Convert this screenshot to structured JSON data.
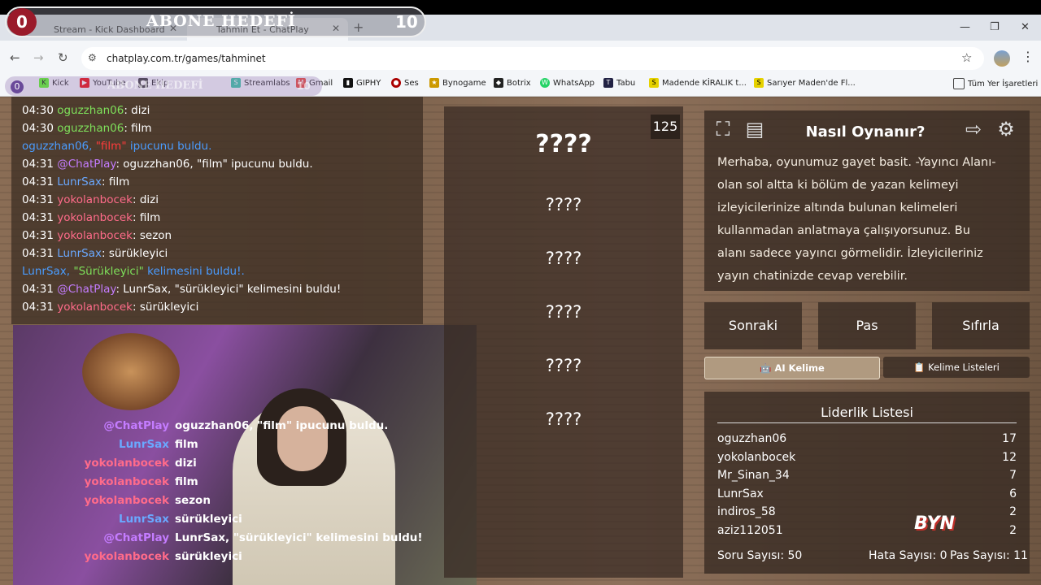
{
  "browser": {
    "tabs": [
      {
        "label": "Stream - Kick Dashboard"
      },
      {
        "label": "Tahmin Et - ChatPlay"
      }
    ],
    "url": "chatplay.com.tr/games/tahminet",
    "bookmarks": [
      {
        "label": "Kick"
      },
      {
        "label": "YouTube"
      },
      {
        "label": "Ekip"
      },
      {
        "label": "Streamlabs"
      },
      {
        "label": "Gmail"
      },
      {
        "label": "GIPHY"
      },
      {
        "label": "Ses"
      },
      {
        "label": "Bynogame"
      },
      {
        "label": "Botrix"
      },
      {
        "label": "WhatsApp"
      },
      {
        "label": "Tabu"
      },
      {
        "label": "Madende KİRALIK t..."
      },
      {
        "label": "Sarıyer Maden'de Fl..."
      }
    ],
    "all_bookmarks": "Tüm Yer İşaretleri"
  },
  "goal": {
    "current": "0",
    "title": "ABONE HEDEFİ",
    "target": "10"
  },
  "chat": [
    {
      "time": "04:30",
      "user": "oguzzhan06",
      "msg": ": dizi",
      "color": "#7ee05a"
    },
    {
      "time": "04:30",
      "user": "oguzzhan06",
      "msg": ": film",
      "color": "#7ee05a"
    },
    {
      "time": "",
      "user": "oguzzhan06, ",
      "hint": "\"film\"",
      "msg": " ipucunu buldu.",
      "color": "#4a9cff",
      "system": true
    },
    {
      "time": "04:31",
      "user": "@ChatPlay",
      "msg": ": oguzzhan06, \"film\" ipucunu buldu.",
      "color": "#c47cff"
    },
    {
      "time": "04:31",
      "user": "LunrSax",
      "msg": ": film",
      "color": "#6aa8ff"
    },
    {
      "time": "04:31",
      "user": "yokolanbocek",
      "msg": ": dizi",
      "color": "#ff6b8a"
    },
    {
      "time": "04:31",
      "user": "yokolanbocek",
      "msg": ": film",
      "color": "#ff6b8a"
    },
    {
      "time": "04:31",
      "user": "yokolanbocek",
      "msg": ": sezon",
      "color": "#ff6b8a"
    },
    {
      "time": "04:31",
      "user": "LunrSax",
      "msg": ": sürükleyici",
      "color": "#6aa8ff"
    },
    {
      "time": "",
      "user": "LunrSax, ",
      "hint": "\"Sürükleyici\"",
      "msg": " kelimesini buldu!.",
      "color": "#4a9cff",
      "system": true
    },
    {
      "time": "04:31",
      "user": "@ChatPlay",
      "msg": ": LunrSax, \"sürükleyici\" kelimesini buldu!",
      "color": "#c47cff"
    },
    {
      "time": "04:31",
      "user": "yokolanbocek",
      "msg": ": sürükleyici",
      "color": "#ff6b8a"
    }
  ],
  "cam_chat": [
    {
      "user": "@ChatPlay",
      "msg": "oguzzhan06, \"film\" ipucunu buldu.",
      "color": "#c47cff"
    },
    {
      "user": "LunrSax",
      "msg": "film",
      "color": "#6aa8ff"
    },
    {
      "user": "yokolanbocek",
      "msg": "dizi",
      "color": "#ff6b8a"
    },
    {
      "user": "yokolanbocek",
      "msg": "film",
      "color": "#ff6b8a"
    },
    {
      "user": "yokolanbocek",
      "msg": "sezon",
      "color": "#ff6b8a"
    },
    {
      "user": "LunrSax",
      "msg": "sürükleyici",
      "color": "#6aa8ff"
    },
    {
      "user": "@ChatPlay",
      "msg": "LunrSax, \"sürükleyici\" kelimesini buldu!",
      "color": "#c47cff"
    },
    {
      "user": "yokolanbocek",
      "msg": "sürükleyici",
      "color": "#ff6b8a"
    }
  ],
  "game": {
    "score": "125",
    "words": [
      "????",
      "????",
      "????",
      "????",
      "????",
      "????"
    ]
  },
  "howto": {
    "title": "Nasıl Oynanır?",
    "body": "Merhaba, oyunumuz gayet basit. -Yayıncı Alanı- olan sol altta ki bölüm de yazan kelimeyi izleyicilerinize altında bulunan kelimeleri kullanmadan anlatmaya çalışıyorsunuz. Bu alanı sadece yayıncı görmelidir. İzleyicileriniz yayın chatinizde cevap verebilir."
  },
  "actions": {
    "next": "Sonraki",
    "pass": "Pas",
    "reset": "Sıfırla",
    "ai_word": "🤖 AI Kelime",
    "word_lists": "📋 Kelime Listeleri"
  },
  "leaderboard": {
    "title": "Liderlik Listesi",
    "rows": [
      {
        "name": "oguzzhan06",
        "score": "17"
      },
      {
        "name": "yokolanbocek",
        "score": "12"
      },
      {
        "name": "Mr_Sinan_34",
        "score": "7"
      },
      {
        "name": "LunrSax",
        "score": "6"
      },
      {
        "name": "indiros_58",
        "score": "2"
      },
      {
        "name": "aziz112051",
        "score": "2"
      }
    ]
  },
  "stats": {
    "questions": "Soru Sayısı: 50",
    "errors": "Hata Sayısı: 0",
    "passes": "Pas Sayısı: 11"
  },
  "logo_text": "BYN"
}
